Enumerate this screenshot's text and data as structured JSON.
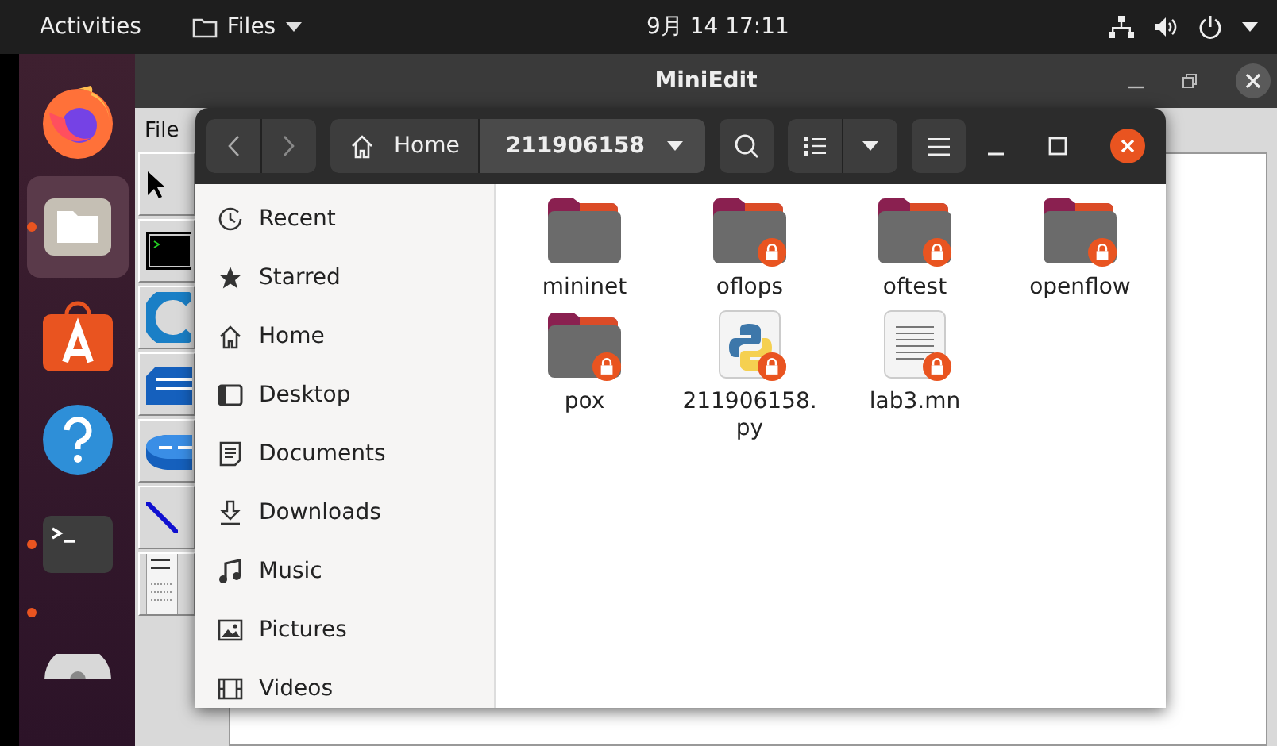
{
  "top_bar": {
    "activities": "Activities",
    "app_menu": "Files",
    "clock": "9月 14  17:11"
  },
  "dock": {
    "items": [
      {
        "kind": "firefox",
        "running": false,
        "selected": false
      },
      {
        "kind": "files",
        "running": true,
        "selected": true
      },
      {
        "kind": "software",
        "running": false,
        "selected": false
      },
      {
        "kind": "help",
        "running": false,
        "selected": false
      },
      {
        "kind": "terminal",
        "running": true,
        "selected": false
      },
      {
        "kind": "other",
        "running": true,
        "selected": false
      },
      {
        "kind": "disc",
        "running": false,
        "selected": false
      }
    ]
  },
  "miniedit": {
    "title": "MiniEdit",
    "menu": [
      "File"
    ],
    "tools": [
      {
        "kind": "select"
      },
      {
        "kind": "host"
      },
      {
        "kind": "controller"
      },
      {
        "kind": "switch"
      },
      {
        "kind": "router"
      },
      {
        "kind": "link"
      },
      {
        "kind": "netlink"
      }
    ]
  },
  "files_window": {
    "path": [
      {
        "label": "Home",
        "kind": "home",
        "selected": false
      },
      {
        "label": "211906158",
        "kind": "folder",
        "selected": true
      }
    ],
    "sidebar": {
      "items": [
        {
          "label": "Recent",
          "kind": "recent",
          "selected": false
        },
        {
          "label": "Starred",
          "kind": "starred",
          "selected": false
        },
        {
          "label": "Home",
          "kind": "home",
          "selected": false
        },
        {
          "label": "Desktop",
          "kind": "desktop",
          "selected": false
        },
        {
          "label": "Documents",
          "kind": "documents",
          "selected": false
        },
        {
          "label": "Downloads",
          "kind": "downloads",
          "selected": false
        },
        {
          "label": "Music",
          "kind": "music",
          "selected": false
        },
        {
          "label": "Pictures",
          "kind": "pictures",
          "selected": false
        },
        {
          "label": "Videos",
          "kind": "videos",
          "selected": false
        }
      ]
    },
    "items": [
      {
        "name": "mininet",
        "kind": "folder",
        "locked": false
      },
      {
        "name": "oflops",
        "kind": "folder",
        "locked": true
      },
      {
        "name": "oftest",
        "kind": "folder",
        "locked": true
      },
      {
        "name": "openflow",
        "kind": "folder",
        "locked": true
      },
      {
        "name": "pox",
        "kind": "folder",
        "locked": true
      },
      {
        "name": "211906158.\npy",
        "kind": "python",
        "locked": true
      },
      {
        "name": "lab3.mn",
        "kind": "text",
        "locked": true
      }
    ]
  }
}
